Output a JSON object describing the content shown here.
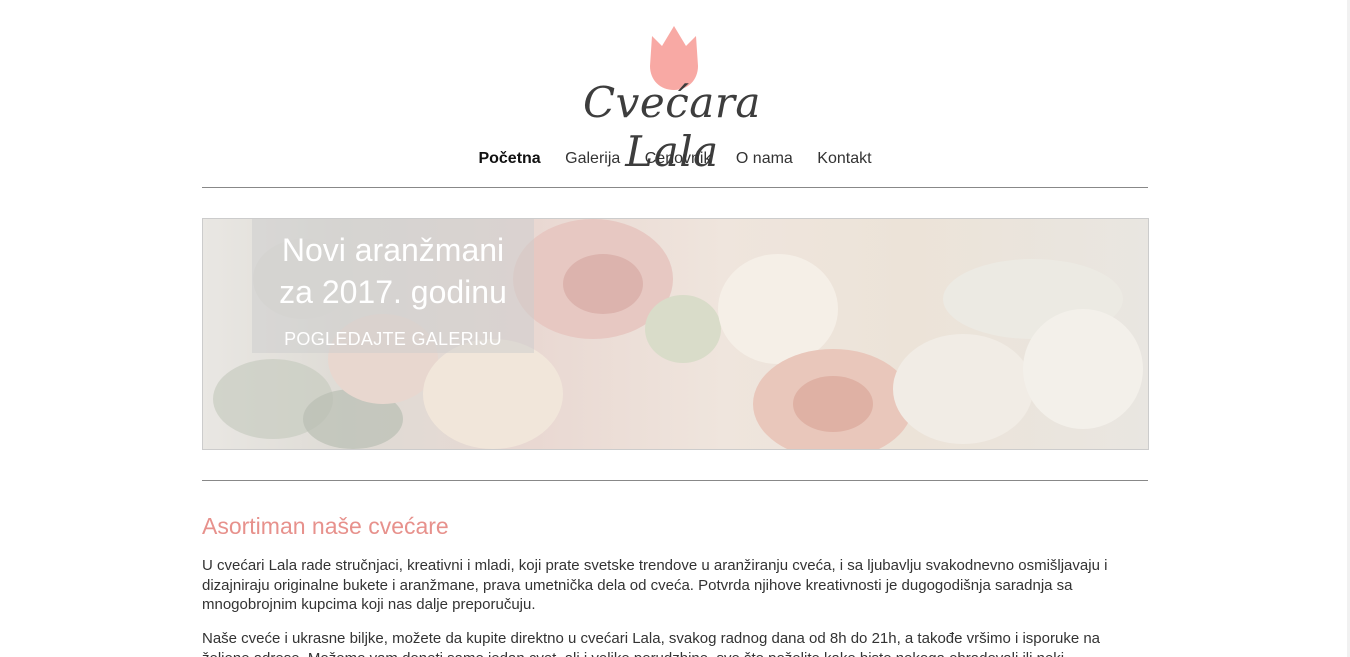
{
  "brand": {
    "name": "Cvećara Lala",
    "accent": "#e7918c",
    "tulip_color": "#f8a9a4"
  },
  "nav": {
    "items": [
      {
        "label": "Početna",
        "active": true
      },
      {
        "label": "Galerija",
        "active": false
      },
      {
        "label": "Cenovnik",
        "active": false
      },
      {
        "label": "O nama",
        "active": false
      },
      {
        "label": "Kontakt",
        "active": false
      }
    ]
  },
  "banner": {
    "title_line1": "Novi aranžmani",
    "title_line2": "za 2017. godinu",
    "cta": "POGLEDAJTE GALERIJU"
  },
  "content": {
    "heading": "Asortiman naše cvećare",
    "paragraph1": "U cvećari Lala rade stručnjaci, kreativni i mladi, koji prate svetske trendove u aranžiranju cveća, i sa ljubavlju svakodnevno osmišljavaju i dizajniraju originalne bukete i aranžmane, prava umetnička dela od cveća. Potvrda njihove kreativnosti je dugogodišnja saradnja sa mnogobrojnim kupcima koji nas dalje preporučuju.",
    "paragraph2": "Naše cveće i ukrasne biljke, možete da kupite direktno u cvećari Lala, svakog radnog dana od 8h do 21h, a takođe vršimo i isporuke na željene adrese. Možemo vam doneti samo jedan cvet, ali i velike porudzbine, sve što poželite kako biste nekoga obradovali ili neki"
  }
}
